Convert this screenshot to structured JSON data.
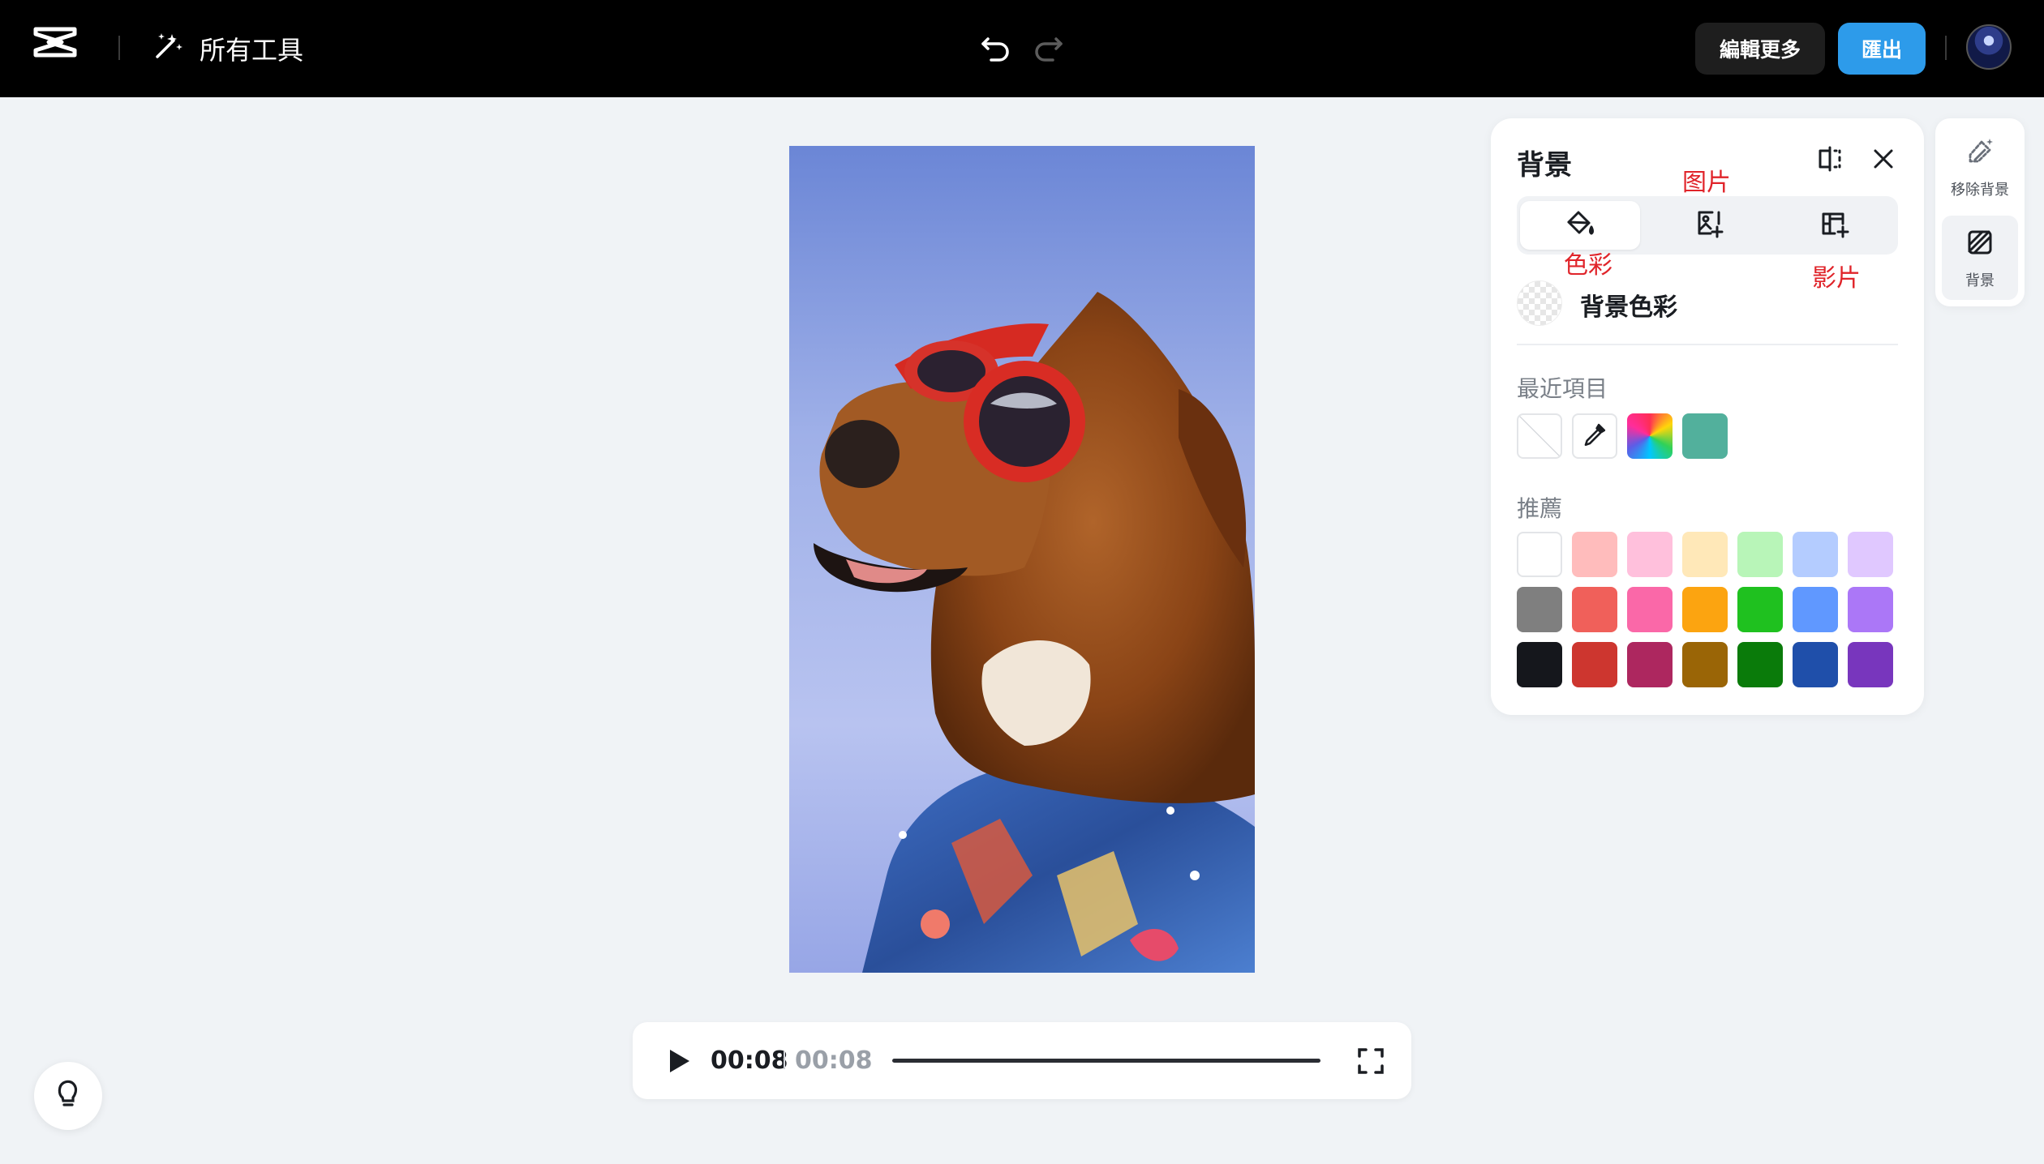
{
  "topbar": {
    "tools_label": "所有工具",
    "edit_more_label": "編輯更多",
    "export_label": "匯出"
  },
  "player": {
    "current_time": "00:08",
    "total_time": "00:08"
  },
  "panel": {
    "title": "背景",
    "tabs": [
      {
        "name": "color",
        "icon": "paint-bucket-icon",
        "label": "色彩",
        "active": true
      },
      {
        "name": "image",
        "icon": "image-add-icon",
        "label": "图片",
        "active": false
      },
      {
        "name": "video",
        "icon": "film-add-icon",
        "label": "影片",
        "active": false
      }
    ],
    "background_color_label": "背景色彩",
    "recent_label": "最近項目",
    "recent": [
      {
        "type": "none"
      },
      {
        "type": "eyedropper",
        "icon": "eyedropper-icon"
      },
      {
        "type": "rainbow"
      },
      {
        "type": "color",
        "color": "#52b09c"
      }
    ],
    "recommended_label": "推薦",
    "recommended": [
      [
        "#ffffff",
        "#ffbcbc",
        "#ffc0dc",
        "#ffe8b8",
        "#b8f5b8",
        "#b4ccff",
        "#e0c8ff"
      ],
      [
        "#7f7f7f",
        "#f0605a",
        "#fa68a8",
        "#fca410",
        "#1fc11f",
        "#6098ff",
        "#ab77f7"
      ],
      [
        "#15171c",
        "#cd362f",
        "#ad275f",
        "#9a6506",
        "#0a7b0a",
        "#1f4faa",
        "#7836bd"
      ]
    ]
  },
  "rail": {
    "items": [
      {
        "label": "移除背景",
        "icon": "magic-eraser-icon",
        "active": false
      },
      {
        "label": "背景",
        "icon": "background-icon",
        "active": true
      }
    ]
  },
  "colors": {
    "topbar_bg": "#000000",
    "canvas_bg": "#f0f3f6",
    "export_blue": "#2d9bea",
    "annotation_red": "#e0242a"
  }
}
